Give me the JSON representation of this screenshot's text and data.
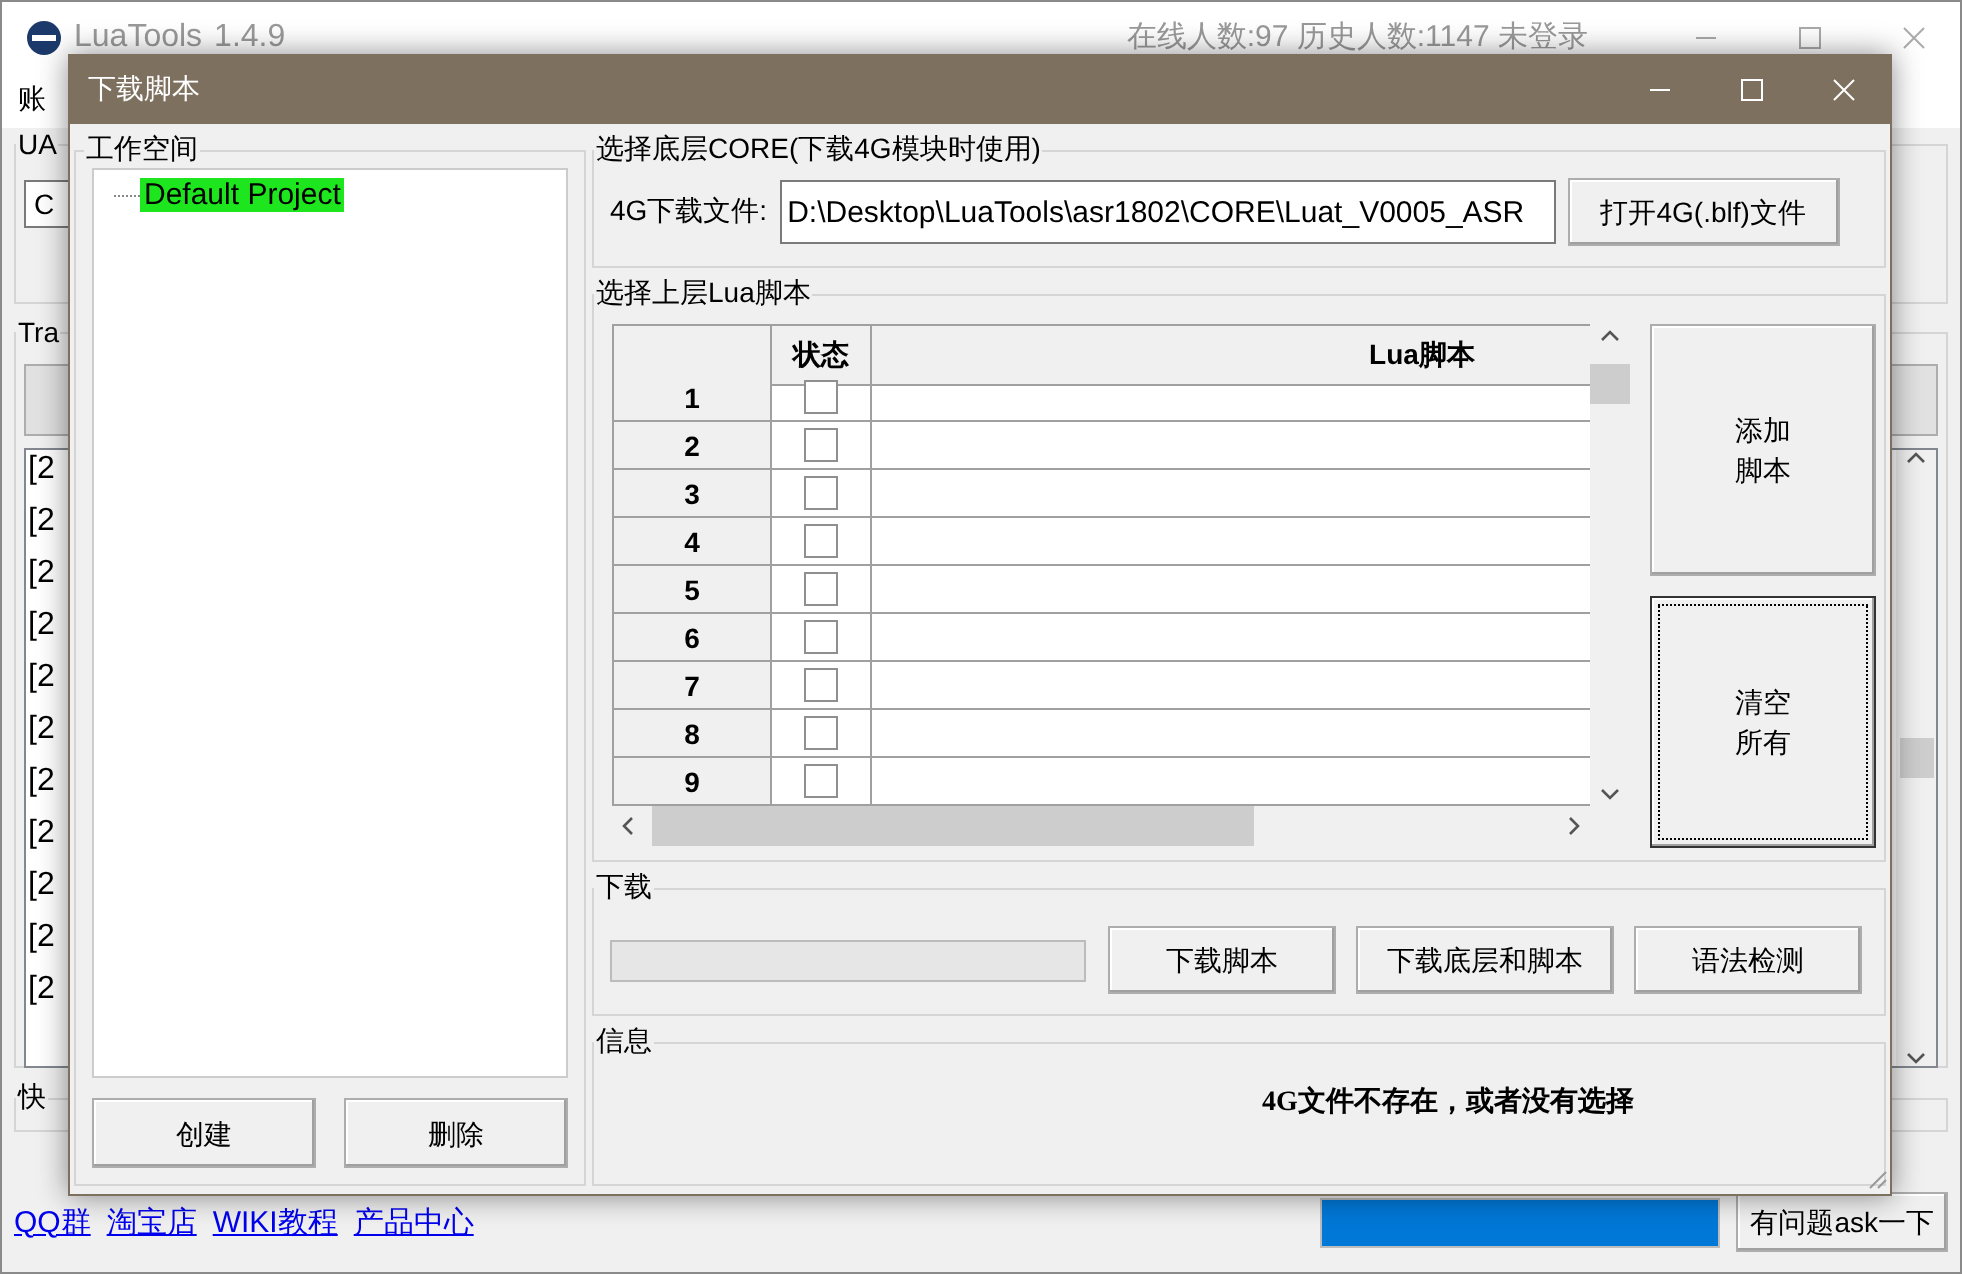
{
  "main_window": {
    "title": "LuaTools",
    "version": "1.4.9",
    "status": "在线人数:97 历史人数:1147 未登录",
    "menu": [
      "账"
    ],
    "uart_group": {
      "label": "UA",
      "field_value": "C"
    },
    "trace_group": {
      "label": "Tra",
      "log_lines": [
        "[2",
        "[2",
        "[2",
        "[2",
        "[2",
        "[2",
        "[2",
        "[2",
        "[2",
        "[2",
        "[2"
      ]
    },
    "quick_group": {
      "label": "快"
    },
    "links": [
      "QQ群",
      "淘宝店",
      "WIKI教程",
      "产品中心"
    ],
    "progress": {
      "level": 1
    },
    "ask_button": "有问题ask一下"
  },
  "dialog": {
    "title": "下载脚本",
    "workspace": {
      "label": "工作空间",
      "tree": [
        {
          "label": "Default Project",
          "selected": true
        }
      ],
      "buttons": [
        "创建",
        "删除"
      ]
    },
    "core": {
      "label": "选择底层CORE(下载4G模块时使用)",
      "field_label": "4G下载文件:",
      "field_value": "D:\\Desktop\\LuaTools\\asr1802\\CORE\\Luat_V0005_ASR",
      "button": "打开4G(.blf)文件"
    },
    "scripts": {
      "label": "选择上层Lua脚本",
      "columns": [
        "状态",
        "Lua脚本"
      ],
      "rows": [
        {
          "index": "1",
          "checked": false
        },
        {
          "index": "2",
          "checked": false
        },
        {
          "index": "3",
          "checked": false
        },
        {
          "index": "4",
          "checked": false
        },
        {
          "index": "5",
          "checked": false
        },
        {
          "index": "6",
          "checked": false
        },
        {
          "index": "7",
          "checked": false
        },
        {
          "index": "8",
          "checked": false
        },
        {
          "index": "9",
          "checked": false
        }
      ],
      "buttons": [
        {
          "label": "添加脚本",
          "focused": false
        },
        {
          "label": "清空所有",
          "focused": true
        }
      ]
    },
    "download": {
      "label": "下载",
      "progress": {
        "level": 0
      },
      "buttons": [
        "下载脚本",
        "下载底层和脚本",
        "语法检测"
      ]
    },
    "info": {
      "label": "信息",
      "message": "4G文件不存在，或者没有选择"
    }
  }
}
